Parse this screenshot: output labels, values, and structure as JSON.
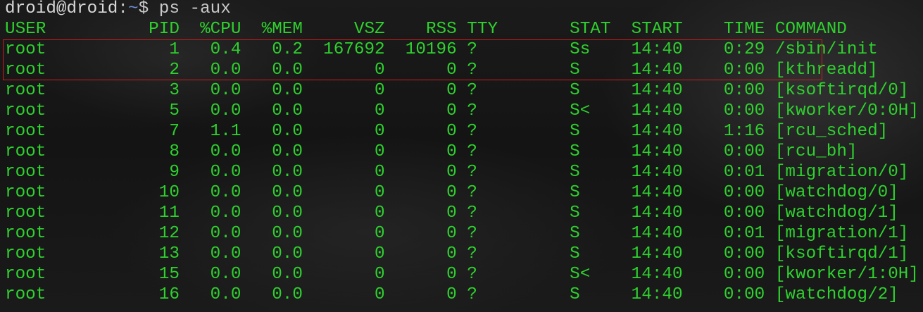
{
  "prompt": {
    "user_host": "droid@droid",
    "separator": ":",
    "path": "~",
    "symbol": "$",
    "command": "ps -aux"
  },
  "table": {
    "columns": [
      "USER",
      "PID",
      "%CPU",
      "%MEM",
      "VSZ",
      "RSS",
      "TTY",
      "STAT",
      "START",
      "TIME",
      "COMMAND"
    ],
    "rows": [
      [
        "root",
        "1",
        "0.4",
        "0.2",
        "167692",
        "10196",
        "?",
        "Ss",
        "14:40",
        "0:29",
        "/sbin/init"
      ],
      [
        "root",
        "2",
        "0.0",
        "0.0",
        "0",
        "0",
        "?",
        "S",
        "14:40",
        "0:00",
        "[kthreadd]"
      ],
      [
        "root",
        "3",
        "0.0",
        "0.0",
        "0",
        "0",
        "?",
        "S",
        "14:40",
        "0:00",
        "[ksoftirqd/0]"
      ],
      [
        "root",
        "5",
        "0.0",
        "0.0",
        "0",
        "0",
        "?",
        "S<",
        "14:40",
        "0:00",
        "[kworker/0:0H]"
      ],
      [
        "root",
        "7",
        "1.1",
        "0.0",
        "0",
        "0",
        "?",
        "S",
        "14:40",
        "1:16",
        "[rcu_sched]"
      ],
      [
        "root",
        "8",
        "0.0",
        "0.0",
        "0",
        "0",
        "?",
        "S",
        "14:40",
        "0:00",
        "[rcu_bh]"
      ],
      [
        "root",
        "9",
        "0.0",
        "0.0",
        "0",
        "0",
        "?",
        "S",
        "14:40",
        "0:01",
        "[migration/0]"
      ],
      [
        "root",
        "10",
        "0.0",
        "0.0",
        "0",
        "0",
        "?",
        "S",
        "14:40",
        "0:00",
        "[watchdog/0]"
      ],
      [
        "root",
        "11",
        "0.0",
        "0.0",
        "0",
        "0",
        "?",
        "S",
        "14:40",
        "0:00",
        "[watchdog/1]"
      ],
      [
        "root",
        "12",
        "0.0",
        "0.0",
        "0",
        "0",
        "?",
        "S",
        "14:40",
        "0:01",
        "[migration/1]"
      ],
      [
        "root",
        "13",
        "0.0",
        "0.0",
        "0",
        "0",
        "?",
        "S",
        "14:40",
        "0:00",
        "[ksoftirqd/1]"
      ],
      [
        "root",
        "15",
        "0.0",
        "0.0",
        "0",
        "0",
        "?",
        "S<",
        "14:40",
        "0:00",
        "[kworker/1:0H]"
      ],
      [
        "root",
        "16",
        "0.0",
        "0.0",
        "0",
        "0",
        "?",
        "S",
        "14:40",
        "0:00",
        "[watchdog/2]"
      ]
    ],
    "highlighted_rows": [
      0,
      1
    ]
  },
  "colors": {
    "text": "#2ed12e",
    "prompt": "#c9c9c9",
    "path": "#6f8fd8",
    "highlight_border": "#d01c1c"
  }
}
